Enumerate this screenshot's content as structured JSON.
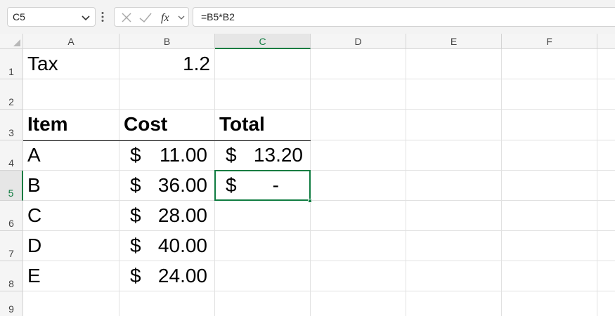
{
  "formula_bar": {
    "name_box": "C5",
    "formula": "=B5*B2"
  },
  "columns": [
    "A",
    "B",
    "C",
    "D",
    "E",
    "F"
  ],
  "rows": [
    "1",
    "2",
    "3",
    "4",
    "5",
    "6",
    "7",
    "8",
    "9"
  ],
  "cells": {
    "A1": "Tax",
    "B1": "1.2",
    "A3": "Item",
    "B3": "Cost",
    "C3": "Total",
    "A4": "A",
    "A5": "B",
    "A6": "C",
    "A7": "D",
    "A8": "E",
    "currency_symbol": "$",
    "B4": "11.00",
    "B5": "36.00",
    "B6": "28.00",
    "B7": "40.00",
    "B8": "24.00",
    "C4": "13.20",
    "C5": "-"
  },
  "selected_cell": "C5",
  "colors": {
    "accent": "#107c41",
    "grid_line": "#e1e1e1",
    "header_bg": "#f5f5f5"
  }
}
